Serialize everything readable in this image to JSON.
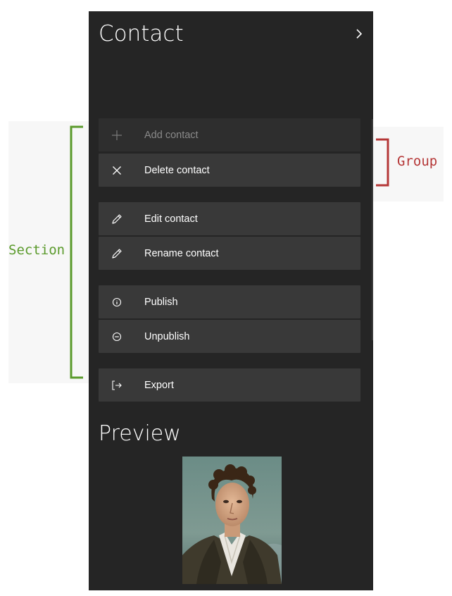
{
  "panel": {
    "title": "Contact",
    "more_icon": "chevron-right-icon",
    "items": [
      {
        "label": "Add contact",
        "icon": "plus-icon",
        "disabled": true
      },
      {
        "label": "Delete contact",
        "icon": "close-icon"
      },
      {
        "label": "Edit contact",
        "icon": "pencil-icon"
      },
      {
        "label": "Rename contact",
        "icon": "pencil-icon"
      },
      {
        "label": "Publish",
        "icon": "info-icon"
      },
      {
        "label": "Unpublish",
        "icon": "minus-circle-icon"
      },
      {
        "label": "Export",
        "icon": "export-icon"
      }
    ],
    "preview_title": "Preview",
    "preview_image": "portrait-image"
  },
  "annotations": {
    "section_label": "Section",
    "group_label": "Group",
    "section_color": "#5a9a2b",
    "group_color": "#b53737"
  },
  "colors": {
    "panel_bg": "#252525",
    "item_bg": "#393939",
    "text": "#ffffff",
    "disabled_text": "#8a8a8a"
  }
}
